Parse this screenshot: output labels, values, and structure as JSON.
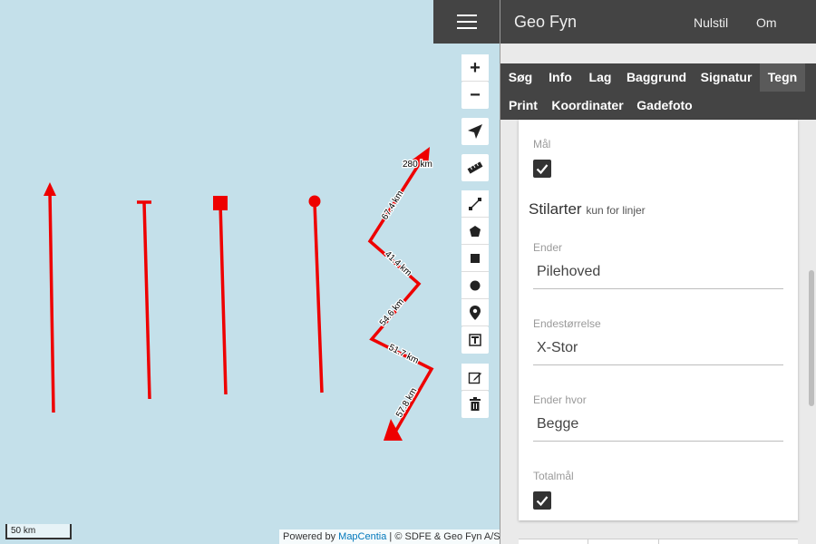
{
  "app": {
    "title": "Geo Fyn",
    "reset_label": "Nulstil",
    "about_label": "Om"
  },
  "tabs": [
    {
      "label": "Søg"
    },
    {
      "label": "Info"
    },
    {
      "label": "Lag"
    },
    {
      "label": "Baggrund"
    },
    {
      "label": "Signatur"
    },
    {
      "label": "Tegn",
      "active": true
    },
    {
      "label": "Print"
    },
    {
      "label": "Koordinater"
    },
    {
      "label": "Gadefoto"
    }
  ],
  "form": {
    "measure": {
      "label": "Mål",
      "checked": true
    },
    "styles_title": "Stilarter",
    "styles_subtitle": "kun for linjer",
    "ends": {
      "label": "Ender",
      "value": "Pilehoved"
    },
    "end_size": {
      "label": "Endestørrelse",
      "value": "X-Stor"
    },
    "ends_where": {
      "label": "Ender hvor",
      "value": "Begge"
    },
    "total": {
      "label": "Totalmål",
      "checked": true
    }
  },
  "map": {
    "zoom_in": "+",
    "zoom_out": "−",
    "scale_label": "50 km",
    "attribution_prefix": "Powered by ",
    "attribution_link": "MapCentia",
    "attribution_suffix": " | © SDFE & Geo Fyn A/S",
    "segment_labels": [
      "280 km",
      "67.4 km",
      "41.4 km",
      "54.6 km",
      "51.7 km",
      "57.8 km"
    ],
    "draw_color": "#ee0000",
    "background_color": "#c4e0ea"
  },
  "toolbar_icons": [
    "locate-icon",
    "ruler-icon",
    "line-icon",
    "polygon-icon",
    "rectangle-icon",
    "circle-icon",
    "marker-icon",
    "text-icon",
    "edit-icon",
    "trash-icon"
  ]
}
